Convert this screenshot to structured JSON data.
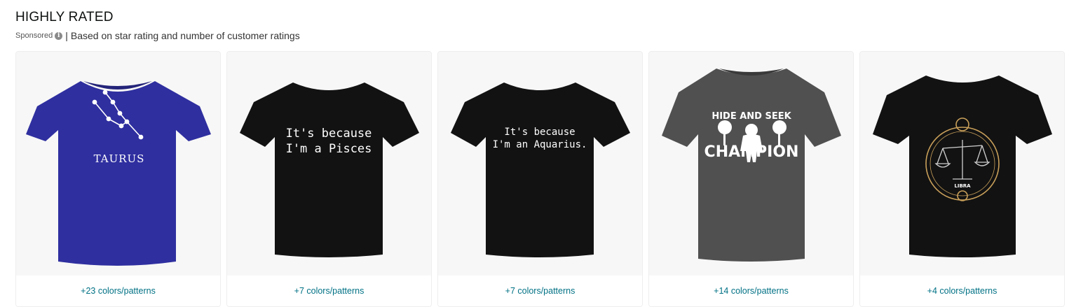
{
  "section": {
    "title": "HIGHLY RATED",
    "sponsored_label": "Sponsored",
    "info_icon": "info-icon",
    "separator": "|",
    "description": "Based on star rating and number of customer ratings"
  },
  "products": [
    {
      "shirt_color": "#2f2fa0",
      "design_text_1": "TAURUS",
      "variants": "+23 colors/patterns"
    },
    {
      "shirt_color": "#121212",
      "design_text_1": "It's because",
      "design_text_2": "I'm a Pisces",
      "variants": "+7 colors/patterns"
    },
    {
      "shirt_color": "#121212",
      "design_text_1": "It's because",
      "design_text_2": "I'm an Aquarius.",
      "variants": "+7 colors/patterns"
    },
    {
      "shirt_color": "#505050",
      "design_text_1": "HIDE AND SEEK",
      "design_text_2": "CHAMPION",
      "variants": "+14 colors/patterns"
    },
    {
      "shirt_color": "#121212",
      "design_text_1": "LIBRA",
      "variants": "+4 colors/patterns"
    }
  ],
  "colors": {
    "link": "#007185",
    "card_bg": "#f7f7f7"
  }
}
